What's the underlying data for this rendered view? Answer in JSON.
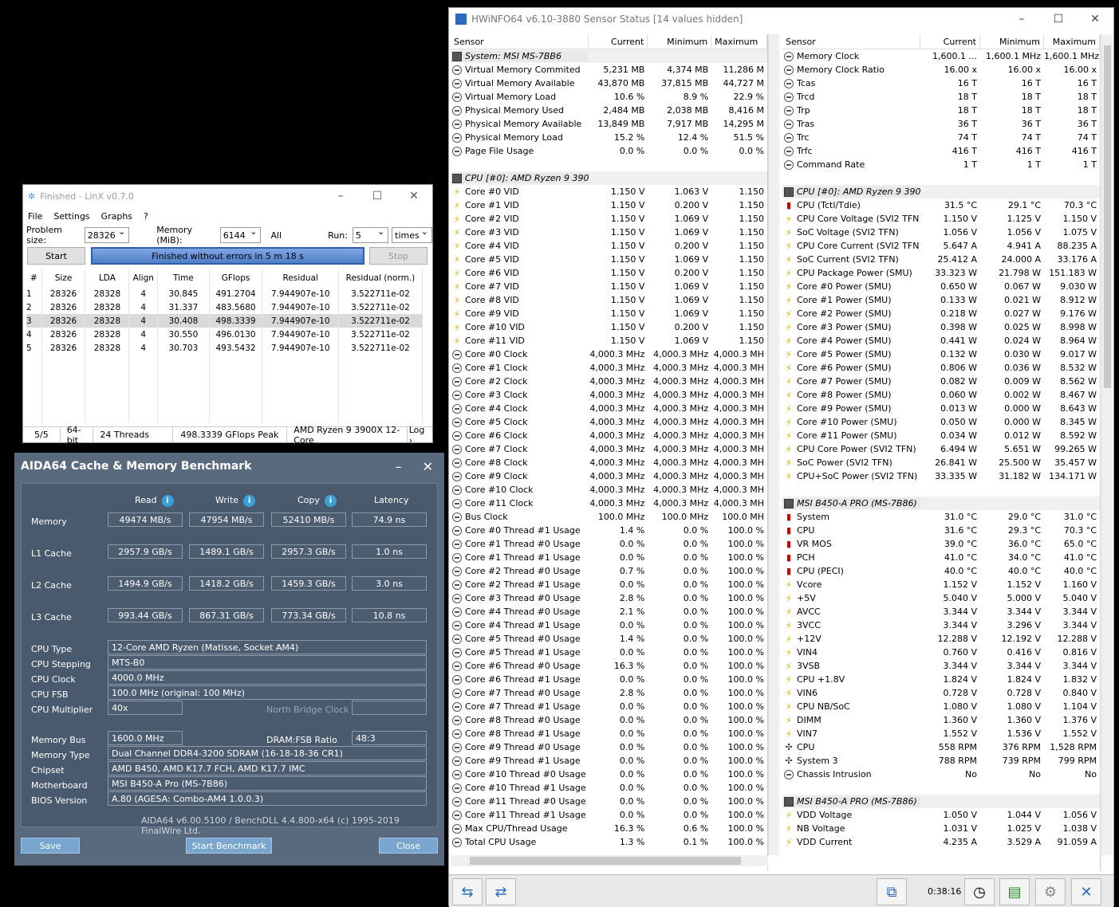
{
  "linx": {
    "title": "Finished - LinX v0.7.0",
    "menu": [
      "File",
      "Settings",
      "Graphs",
      "?"
    ],
    "problem_size_label": "Problem size:",
    "problem_size": "28326",
    "memory_label": "Memory (MiB):",
    "memory": "6144",
    "all_label": "All",
    "run_label": "Run:",
    "run": "5",
    "times": "times",
    "start": "Start",
    "progress_text": "Finished without errors in 5 m 18 s",
    "stop": "Stop",
    "columns": [
      "#",
      "Size",
      "LDA",
      "Align",
      "Time",
      "GFlops",
      "Residual",
      "Residual (norm.)"
    ],
    "rows": [
      [
        "1",
        "28326",
        "28328",
        "4",
        "30.845",
        "491.2704",
        "7.944907e-10",
        "3.522711e-02"
      ],
      [
        "2",
        "28326",
        "28328",
        "4",
        "31.337",
        "483.5680",
        "7.944907e-10",
        "3.522711e-02"
      ],
      [
        "3",
        "28326",
        "28328",
        "4",
        "30.408",
        "498.3339",
        "7.944907e-10",
        "3.522711e-02"
      ],
      [
        "4",
        "28326",
        "28328",
        "4",
        "30.550",
        "496.0130",
        "7.944907e-10",
        "3.522711e-02"
      ],
      [
        "5",
        "28326",
        "28328",
        "4",
        "30.703",
        "493.5432",
        "7.944907e-10",
        "3.522711e-02"
      ]
    ],
    "status": [
      "5/5",
      "64-bit",
      "24 Threads",
      "498.3339 GFlops Peak",
      "AMD Ryzen 9 3900X 12-Core",
      "Log ›"
    ]
  },
  "aida": {
    "title": "AIDA64 Cache & Memory Benchmark",
    "col_read": "Read",
    "col_write": "Write",
    "col_copy": "Copy",
    "col_latency": "Latency",
    "bench": [
      {
        "label": "Memory",
        "read": "49474 MB/s",
        "write": "47954 MB/s",
        "copy": "52410 MB/s",
        "lat": "74.9 ns"
      },
      {
        "label": "L1 Cache",
        "read": "2957.9 GB/s",
        "write": "1489.1 GB/s",
        "copy": "2957.3 GB/s",
        "lat": "1.0 ns"
      },
      {
        "label": "L2 Cache",
        "read": "1494.9 GB/s",
        "write": "1418.2 GB/s",
        "copy": "1459.3 GB/s",
        "lat": "3.0 ns"
      },
      {
        "label": "L3 Cache",
        "read": "993.44 GB/s",
        "write": "867.31 GB/s",
        "copy": "773.34 GB/s",
        "lat": "10.8 ns"
      }
    ],
    "cpu_type_l": "CPU Type",
    "cpu_type": "12-Core AMD Ryzen  (Matisse, Socket AM4)",
    "cpu_step_l": "CPU Stepping",
    "cpu_step": "MTS-B0",
    "cpu_clock_l": "CPU Clock",
    "cpu_clock": "4000.0 MHz",
    "cpu_fsb_l": "CPU FSB",
    "cpu_fsb": "100.0 MHz  (original: 100 MHz)",
    "cpu_mult_l": "CPU Multiplier",
    "cpu_mult": "40x",
    "nb_clock_l": "North Bridge Clock",
    "mem_bus_l": "Memory Bus",
    "mem_bus": "1600.0 MHz",
    "dram_l": "DRAM:FSB Ratio",
    "dram": "48:3",
    "mem_type_l": "Memory Type",
    "mem_type": "Dual Channel DDR4-3200 SDRAM  (16-18-18-36 CR1)",
    "chipset_l": "Chipset",
    "chipset": "AMD B450, AMD K17.7 FCH, AMD K17.7 IMC",
    "mobo_l": "Motherboard",
    "mobo": "MSI B450-A Pro (MS-7B86)",
    "bios_l": "BIOS Version",
    "bios": "A.80  (AGESA: Combo-AM4 1.0.0.3)",
    "footer": "AIDA64 v6.00.5100 / BenchDLL 4.4.800-x64  (c) 1995-2019 FinalWire Ltd.",
    "save": "Save",
    "start": "Start Benchmark",
    "close": "Close"
  },
  "hw": {
    "title": "HWiNFO64 v6.10-3880 Sensor Status [14 values hidden]",
    "hdr": [
      "Sensor",
      "Current",
      "Minimum",
      "Maximum"
    ],
    "left": [
      [
        "g",
        "System: MSI MS-7BB6",
        "",
        "",
        ""
      ],
      [
        "c",
        "Virtual Memory Commited",
        "5,231 MB",
        "4,374 MB",
        "11,286 M"
      ],
      [
        "c",
        "Virtual Memory Available",
        "43,870 MB",
        "37,815 MB",
        "44,727 M"
      ],
      [
        "c",
        "Virtual Memory Load",
        "10.6 %",
        "8.9 %",
        "22.9 %"
      ],
      [
        "c",
        "Physical Memory Used",
        "2,484 MB",
        "2,038 MB",
        "8,416 M"
      ],
      [
        "c",
        "Physical Memory Available",
        "13,849 MB",
        "7,917 MB",
        "14,295 M"
      ],
      [
        "c",
        "Physical Memory Load",
        "15.2 %",
        "12.4 %",
        "51.5 %"
      ],
      [
        "c",
        "Page File Usage",
        "0.0 %",
        "0.0 %",
        "0.0 %"
      ],
      [
        "e",
        "",
        "",
        "",
        ""
      ],
      [
        "g",
        "CPU [#0]: AMD Ryzen 9 3900X",
        "",
        "",
        ""
      ],
      [
        "b",
        "Core #0 VID",
        "1.150 V",
        "1.063 V",
        "1.150"
      ],
      [
        "b",
        "Core #1 VID",
        "1.150 V",
        "0.200 V",
        "1.150"
      ],
      [
        "b",
        "Core #2 VID",
        "1.150 V",
        "1.069 V",
        "1.150"
      ],
      [
        "b",
        "Core #3 VID",
        "1.150 V",
        "1.069 V",
        "1.150"
      ],
      [
        "b",
        "Core #4 VID",
        "1.150 V",
        "0.200 V",
        "1.150"
      ],
      [
        "b",
        "Core #5 VID",
        "1.150 V",
        "1.069 V",
        "1.150"
      ],
      [
        "b",
        "Core #6 VID",
        "1.150 V",
        "0.200 V",
        "1.150"
      ],
      [
        "b",
        "Core #7 VID",
        "1.150 V",
        "1.069 V",
        "1.150"
      ],
      [
        "b",
        "Core #8 VID",
        "1.150 V",
        "1.069 V",
        "1.150"
      ],
      [
        "b",
        "Core #9 VID",
        "1.150 V",
        "1.069 V",
        "1.150"
      ],
      [
        "b",
        "Core #10 VID",
        "1.150 V",
        "0.200 V",
        "1.150"
      ],
      [
        "b",
        "Core #11 VID",
        "1.150 V",
        "1.069 V",
        "1.150"
      ],
      [
        "c",
        "Core #0 Clock",
        "4,000.3 MHz",
        "4,000.3 MHz",
        "4,000.3 MH"
      ],
      [
        "c",
        "Core #1 Clock",
        "4,000.3 MHz",
        "4,000.3 MHz",
        "4,000.3 MH"
      ],
      [
        "c",
        "Core #2 Clock",
        "4,000.3 MHz",
        "4,000.3 MHz",
        "4,000.3 MH"
      ],
      [
        "c",
        "Core #3 Clock",
        "4,000.3 MHz",
        "4,000.3 MHz",
        "4,000.3 MH"
      ],
      [
        "c",
        "Core #4 Clock",
        "4,000.3 MHz",
        "4,000.3 MHz",
        "4,000.3 MH"
      ],
      [
        "c",
        "Core #5 Clock",
        "4,000.3 MHz",
        "4,000.3 MHz",
        "4,000.3 MH"
      ],
      [
        "c",
        "Core #6 Clock",
        "4,000.3 MHz",
        "4,000.3 MHz",
        "4,000.3 MH"
      ],
      [
        "c",
        "Core #7 Clock",
        "4,000.3 MHz",
        "4,000.3 MHz",
        "4,000.3 MH"
      ],
      [
        "c",
        "Core #8 Clock",
        "4,000.3 MHz",
        "4,000.3 MHz",
        "4,000.3 MH"
      ],
      [
        "c",
        "Core #9 Clock",
        "4,000.3 MHz",
        "4,000.3 MHz",
        "4,000.3 MH"
      ],
      [
        "c",
        "Core #10 Clock",
        "4,000.3 MHz",
        "4,000.3 MHz",
        "4,000.3 MH"
      ],
      [
        "c",
        "Core #11 Clock",
        "4,000.3 MHz",
        "4,000.3 MHz",
        "4,000.3 MH"
      ],
      [
        "c",
        "Bus Clock",
        "100.0 MHz",
        "100.0 MHz",
        "100.0 MH"
      ],
      [
        "c",
        "Core #0 Thread #1 Usage",
        "1.4 %",
        "0.0 %",
        "100.0 %"
      ],
      [
        "c",
        "Core #1 Thread #0 Usage",
        "0.0 %",
        "0.0 %",
        "100.0 %"
      ],
      [
        "c",
        "Core #1 Thread #1 Usage",
        "0.0 %",
        "0.0 %",
        "100.0 %"
      ],
      [
        "c",
        "Core #2 Thread #0 Usage",
        "0.7 %",
        "0.0 %",
        "100.0 %"
      ],
      [
        "c",
        "Core #2 Thread #1 Usage",
        "0.0 %",
        "0.0 %",
        "100.0 %"
      ],
      [
        "c",
        "Core #3 Thread #0 Usage",
        "2.8 %",
        "0.0 %",
        "100.0 %"
      ],
      [
        "c",
        "Core #4 Thread #0 Usage",
        "2.1 %",
        "0.0 %",
        "100.0 %"
      ],
      [
        "c",
        "Core #4 Thread #1 Usage",
        "0.0 %",
        "0.0 %",
        "100.0 %"
      ],
      [
        "c",
        "Core #5 Thread #0 Usage",
        "1.4 %",
        "0.0 %",
        "100.0 %"
      ],
      [
        "c",
        "Core #5 Thread #1 Usage",
        "0.0 %",
        "0.0 %",
        "100.0 %"
      ],
      [
        "c",
        "Core #6 Thread #0 Usage",
        "16.3 %",
        "0.0 %",
        "100.0 %"
      ],
      [
        "c",
        "Core #6 Thread #1 Usage",
        "0.0 %",
        "0.0 %",
        "100.0 %"
      ],
      [
        "c",
        "Core #7 Thread #0 Usage",
        "2.8 %",
        "0.0 %",
        "100.0 %"
      ],
      [
        "c",
        "Core #7 Thread #1 Usage",
        "0.0 %",
        "0.0 %",
        "100.0 %"
      ],
      [
        "c",
        "Core #8 Thread #0 Usage",
        "0.0 %",
        "0.0 %",
        "100.0 %"
      ],
      [
        "c",
        "Core #8 Thread #1 Usage",
        "0.0 %",
        "0.0 %",
        "100.0 %"
      ],
      [
        "c",
        "Core #9 Thread #0 Usage",
        "0.0 %",
        "0.0 %",
        "100.0 %"
      ],
      [
        "c",
        "Core #9 Thread #1 Usage",
        "0.0 %",
        "0.0 %",
        "100.0 %"
      ],
      [
        "c",
        "Core #10 Thread #0 Usage",
        "0.0 %",
        "0.0 %",
        "100.0 %"
      ],
      [
        "c",
        "Core #10 Thread #1 Usage",
        "0.0 %",
        "0.0 %",
        "100.0 %"
      ],
      [
        "c",
        "Core #11 Thread #0 Usage",
        "0.0 %",
        "0.0 %",
        "100.0 %"
      ],
      [
        "c",
        "Core #11 Thread #1 Usage",
        "0.0 %",
        "0.0 %",
        "100.0 %"
      ],
      [
        "c",
        "Max CPU/Thread Usage",
        "16.3 %",
        "0.6 %",
        "100.0 %"
      ],
      [
        "c",
        "Total CPU Usage",
        "1.3 %",
        "0.1 %",
        "100.0 %"
      ]
    ],
    "right": [
      [
        "c",
        "Memory Clock",
        "1,600.1 ...",
        "1,600.1 MHz",
        "1,600.1 MHz"
      ],
      [
        "c",
        "Memory Clock Ratio",
        "16.00 x",
        "16.00 x",
        "16.00 x"
      ],
      [
        "c",
        "Tcas",
        "16 T",
        "16 T",
        "16 T"
      ],
      [
        "c",
        "Trcd",
        "18 T",
        "18 T",
        "18 T"
      ],
      [
        "c",
        "Trp",
        "18 T",
        "18 T",
        "18 T"
      ],
      [
        "c",
        "Tras",
        "36 T",
        "36 T",
        "36 T"
      ],
      [
        "c",
        "Trc",
        "74 T",
        "74 T",
        "74 T"
      ],
      [
        "c",
        "Trfc",
        "416 T",
        "416 T",
        "416 T"
      ],
      [
        "c",
        "Command Rate",
        "1 T",
        "1 T",
        "1 T"
      ],
      [
        "e",
        "",
        "",
        "",
        ""
      ],
      [
        "g",
        "CPU [#0]: AMD Ryzen 9 390...",
        "",
        "",
        ""
      ],
      [
        "t",
        "CPU (Tctl/Tdie)",
        "31.5 °C",
        "29.1 °C",
        "70.3 °C"
      ],
      [
        "b",
        "CPU Core Voltage (SVI2 TFN)",
        "1.150 V",
        "1.125 V",
        "1.150 V"
      ],
      [
        "b",
        "SoC Voltage (SVI2 TFN)",
        "1.056 V",
        "1.056 V",
        "1.075 V"
      ],
      [
        "b",
        "CPU Core Current (SVI2 TFN)",
        "5.647 A",
        "4.941 A",
        "88.235 A"
      ],
      [
        "b",
        "SoC Current (SVI2 TFN)",
        "25.412 A",
        "24.000 A",
        "33.176 A"
      ],
      [
        "b",
        "CPU Package Power (SMU)",
        "33.323 W",
        "21.798 W",
        "151.183 W"
      ],
      [
        "b",
        "Core #0 Power (SMU)",
        "0.650 W",
        "0.067 W",
        "9.030 W"
      ],
      [
        "b",
        "Core #1 Power (SMU)",
        "0.133 W",
        "0.021 W",
        "8.912 W"
      ],
      [
        "b",
        "Core #2 Power (SMU)",
        "0.218 W",
        "0.027 W",
        "9.176 W"
      ],
      [
        "b",
        "Core #3 Power (SMU)",
        "0.398 W",
        "0.025 W",
        "8.998 W"
      ],
      [
        "b",
        "Core #4 Power (SMU)",
        "0.441 W",
        "0.024 W",
        "8.964 W"
      ],
      [
        "b",
        "Core #5 Power (SMU)",
        "0.132 W",
        "0.030 W",
        "9.017 W"
      ],
      [
        "b",
        "Core #6 Power (SMU)",
        "0.806 W",
        "0.036 W",
        "8.532 W"
      ],
      [
        "b",
        "Core #7 Power (SMU)",
        "0.082 W",
        "0.009 W",
        "8.562 W"
      ],
      [
        "b",
        "Core #8 Power (SMU)",
        "0.060 W",
        "0.002 W",
        "8.467 W"
      ],
      [
        "b",
        "Core #9 Power (SMU)",
        "0.013 W",
        "0.000 W",
        "8.643 W"
      ],
      [
        "b",
        "Core #10 Power (SMU)",
        "0.050 W",
        "0.000 W",
        "8.345 W"
      ],
      [
        "b",
        "Core #11 Power (SMU)",
        "0.034 W",
        "0.012 W",
        "8.592 W"
      ],
      [
        "b",
        "CPU Core Power (SVI2 TFN)",
        "6.494 W",
        "5.651 W",
        "99.265 W"
      ],
      [
        "b",
        "SoC Power (SVI2 TFN)",
        "26.841 W",
        "25.500 W",
        "35.457 W"
      ],
      [
        "b",
        "CPU+SoC Power (SVI2 TFN)",
        "33.335 W",
        "31.182 W",
        "134.171 W"
      ],
      [
        "e",
        "",
        "",
        "",
        ""
      ],
      [
        "g",
        "MSI B450-A PRO (MS-7B86) ...",
        "",
        "",
        ""
      ],
      [
        "t",
        "System",
        "31.0 °C",
        "29.0 °C",
        "31.0 °C"
      ],
      [
        "t",
        "CPU",
        "31.6 °C",
        "29.3 °C",
        "70.3 °C"
      ],
      [
        "t",
        "VR MOS",
        "39.0 °C",
        "36.0 °C",
        "65.0 °C"
      ],
      [
        "t",
        "PCH",
        "41.0 °C",
        "34.0 °C",
        "41.0 °C"
      ],
      [
        "t",
        "CPU (PECI)",
        "40.0 °C",
        "40.0 °C",
        "40.0 °C"
      ],
      [
        "b",
        "Vcore",
        "1.152 V",
        "1.152 V",
        "1.160 V"
      ],
      [
        "b",
        "+5V",
        "5.040 V",
        "5.000 V",
        "5.040 V"
      ],
      [
        "b",
        "AVCC",
        "3.344 V",
        "3.344 V",
        "3.344 V"
      ],
      [
        "b",
        "3VCC",
        "3.344 V",
        "3.296 V",
        "3.344 V"
      ],
      [
        "b",
        "+12V",
        "12.288 V",
        "12.192 V",
        "12.288 V"
      ],
      [
        "b",
        "VIN4",
        "0.760 V",
        "0.416 V",
        "0.816 V"
      ],
      [
        "b",
        "3VSB",
        "3.344 V",
        "3.344 V",
        "3.344 V"
      ],
      [
        "b",
        "CPU +1.8V",
        "1.824 V",
        "1.824 V",
        "1.832 V"
      ],
      [
        "b",
        "VIN6",
        "0.728 V",
        "0.728 V",
        "0.840 V"
      ],
      [
        "b",
        "CPU NB/SoC",
        "1.080 V",
        "1.080 V",
        "1.104 V"
      ],
      [
        "b",
        "DIMM",
        "1.360 V",
        "1.360 V",
        "1.376 V"
      ],
      [
        "b",
        "VIN7",
        "1.552 V",
        "1.536 V",
        "1.552 V"
      ],
      [
        "f",
        "CPU",
        "558 RPM",
        "376 RPM",
        "1,528 RPM"
      ],
      [
        "f",
        "System 3",
        "788 RPM",
        "739 RPM",
        "799 RPM"
      ],
      [
        "c",
        "Chassis Intrusion",
        "No",
        "No",
        "No"
      ],
      [
        "e",
        "",
        "",
        "",
        ""
      ],
      [
        "g",
        "MSI B450-A PRO (MS-7B86) ...",
        "",
        "",
        ""
      ],
      [
        "b",
        "VDD Voltage",
        "1.050 V",
        "1.044 V",
        "1.056 V"
      ],
      [
        "b",
        "NB Voltage",
        "1.031 V",
        "1.025 V",
        "1.038 V"
      ],
      [
        "b",
        "VDD Current",
        "4.235 A",
        "3.529 A",
        "91.059 A"
      ]
    ],
    "time": "0:38:16"
  }
}
